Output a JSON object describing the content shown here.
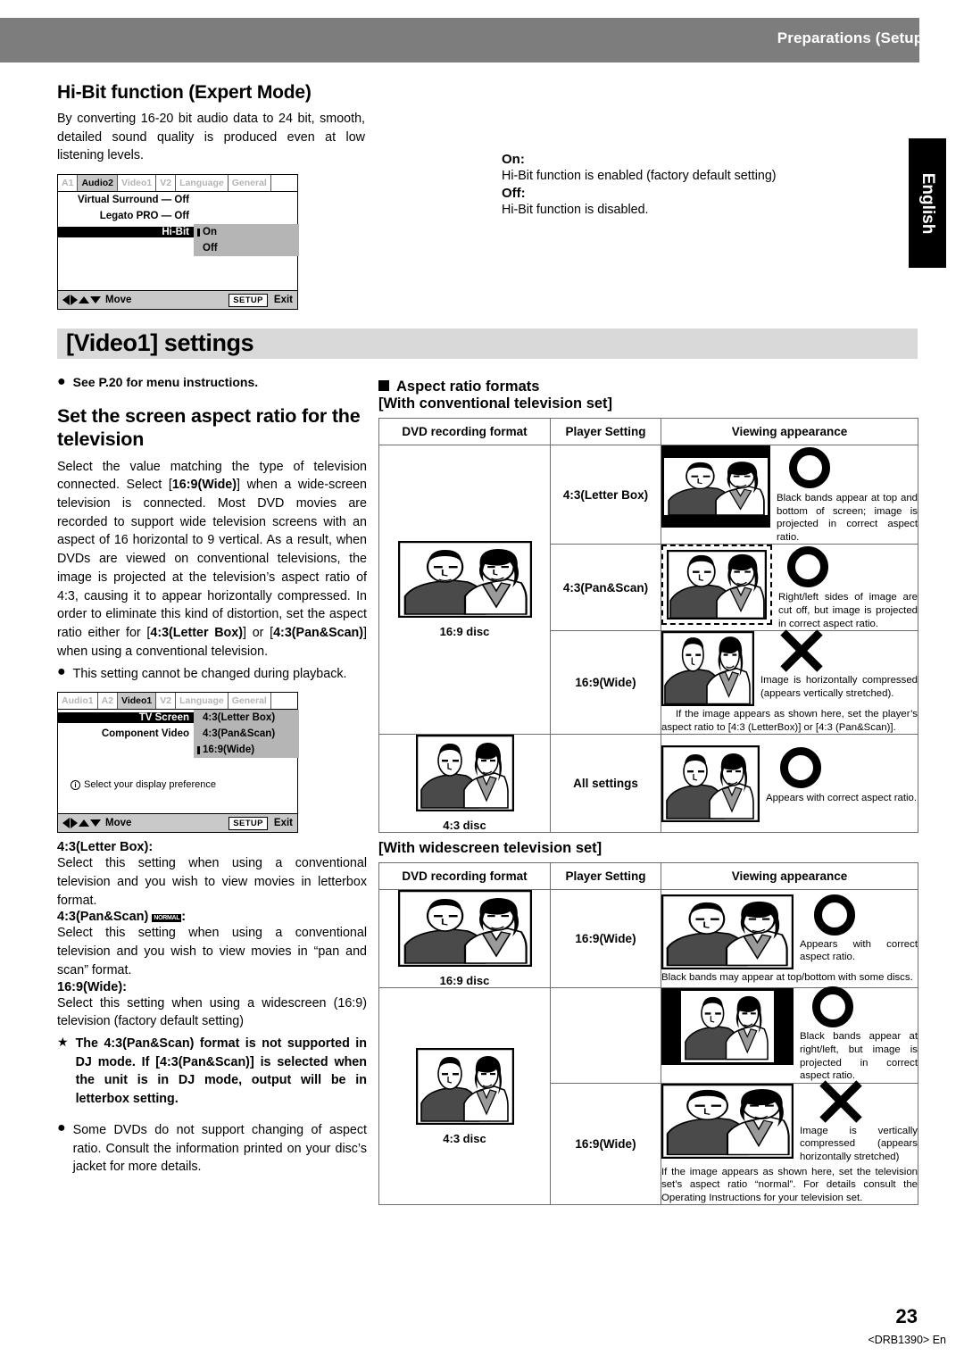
{
  "header": {
    "title": "Preparations (Setup)"
  },
  "sidetab": {
    "label": "English"
  },
  "hibit": {
    "heading": "Hi-Bit function (Expert Mode)",
    "intro": "By converting 16-20 bit audio data to 24 bit, smooth, detailed sound quality is produced even at low listening levels.",
    "on_label": "On:",
    "on_text": "Hi-Bit function is enabled (factory default setting)",
    "off_label": "Off:",
    "off_text": "Hi-Bit function is disabled."
  },
  "osd1": {
    "tabs": [
      "A1",
      "Audio2",
      "Video1",
      "V2",
      "Language",
      "General"
    ],
    "active_tab": "Audio2",
    "rows": [
      {
        "label": "Virtual Surround — Off"
      },
      {
        "label": "Legato PRO — Off"
      },
      {
        "label": "Hi-Bit"
      }
    ],
    "menu": [
      "On",
      "Off"
    ],
    "menu_selected": "On",
    "footer_move": "Move",
    "footer_setup": "SETUP",
    "footer_exit": "Exit"
  },
  "banner": {
    "title": "[Video1] settings"
  },
  "left": {
    "see_page": "See P.20 for menu instructions.",
    "heading": "Set the screen aspect ratio for the television",
    "para1_a": "Select the value matching the type of television connected. Select [",
    "para1_b": "16:9(Wide)",
    "para1_c": "] when a wide-screen television is connected. Most DVD movies are recorded to support wide television screens with an aspect of 16 horizontal to 9 vertical. As a result, when DVDs are viewed on conventional televisions, the image is projected at the television’s aspect ratio of 4:3, causing it to appear horizontally compressed. In order to eliminate this kind of distortion, set the aspect ratio either for [",
    "para1_d": "4:3(Letter Box)",
    "para1_e": "] or [",
    "para1_f": "4:3(Pan&Scan)",
    "para1_g": "] when using a conventional television.",
    "note1": "This setting cannot be changed during playback.",
    "def_lb_title": "4:3(Letter Box):",
    "def_lb_text": "Select this setting when using a conventional television and you wish to view movies in letterbox format.",
    "def_ps_title": "4:3(Pan&Scan)",
    "def_ps_badge": "NORMAL",
    "def_ps_colon": ":",
    "def_ps_text": "Select this setting when using a conventional television and you wish to view movies in “pan and scan” format.",
    "def_w_title": "16:9(Wide):",
    "def_w_text": "Select this setting when using a widescreen (16:9) television (factory default setting)",
    "star_note": "The 4:3(Pan&Scan) format is not supported in DJ mode. If [4:3(Pan&Scan)] is selected when the unit is in DJ mode, output will be in letterbox setting.",
    "note2": "Some DVDs do not support changing of aspect ratio. Consult the information printed on your disc’s jacket for more details."
  },
  "osd2": {
    "tabs": [
      "Audio1",
      "A2",
      "Video1",
      "V2",
      "Language",
      "General"
    ],
    "active_tab": "Video1",
    "rows": [
      {
        "label": "TV Screen"
      },
      {
        "label": "Component Video"
      }
    ],
    "menu": [
      "4:3(Letter Box)",
      "4:3(Pan&Scan)",
      "16:9(Wide)"
    ],
    "menu_selected": "16:9(Wide)",
    "hint": "Select your display preference",
    "footer_move": "Move",
    "footer_setup": "SETUP",
    "footer_exit": "Exit"
  },
  "right": {
    "section_title": "Aspect ratio formats",
    "table1_title": "[With conventional television set]",
    "table2_title": "[With widescreen television set]",
    "columns": [
      "DVD recording format",
      "Player Setting",
      "Viewing appearance"
    ],
    "table1": {
      "disc_rows": [
        {
          "caption": "16:9 disc",
          "span": 3
        },
        {
          "caption": "4:3 disc",
          "span": 1
        }
      ],
      "rows": [
        {
          "setting": "4:3(Letter Box)",
          "mark": "ring",
          "desc": "Black bands appear at top and bottom of screen; image is projected in correct aspect ratio.",
          "desc_full": ""
        },
        {
          "setting": "4:3(Pan&Scan)",
          "mark": "ring",
          "desc": "Right/left sides of image are cut off, but image is projected in correct aspect ratio.",
          "desc_full": ""
        },
        {
          "setting": "16:9(Wide)",
          "mark": "cross",
          "desc": "Image is horizontally compressed (appears vertically stretched).",
          "desc_full": "If the image appears as shown here, set the player’s aspect ratio to [4:3 (LetterBox)] or [4:3 (Pan&Scan)]."
        },
        {
          "setting": "All settings",
          "mark": "ring",
          "desc": "Appears with correct aspect ratio.",
          "desc_full": ""
        }
      ]
    },
    "table2": {
      "disc_rows": [
        {
          "caption": "16:9 disc",
          "span": 1
        },
        {
          "caption": "4:3 disc",
          "span": 2
        }
      ],
      "rows": [
        {
          "setting": "16:9(Wide)",
          "mark": "ring",
          "desc": "Appears with correct aspect ratio.",
          "desc_full": "Black bands may appear at top/bottom with some discs."
        },
        {
          "setting": "",
          "mark": "ring",
          "desc": "Black bands appear at right/left, but image is projected in correct aspect ratio.",
          "desc_full": ""
        },
        {
          "setting": "16:9(Wide)",
          "mark": "cross",
          "desc": "Image is vertically compressed (appears horizontally stretched)",
          "desc_full": "If the image appears as shown here, set the television set’s aspect ratio “normal”. For details consult the Operating Instructions for your television set."
        }
      ]
    }
  },
  "footer": {
    "page": "23",
    "doc_id": "<DRB1390> En"
  }
}
